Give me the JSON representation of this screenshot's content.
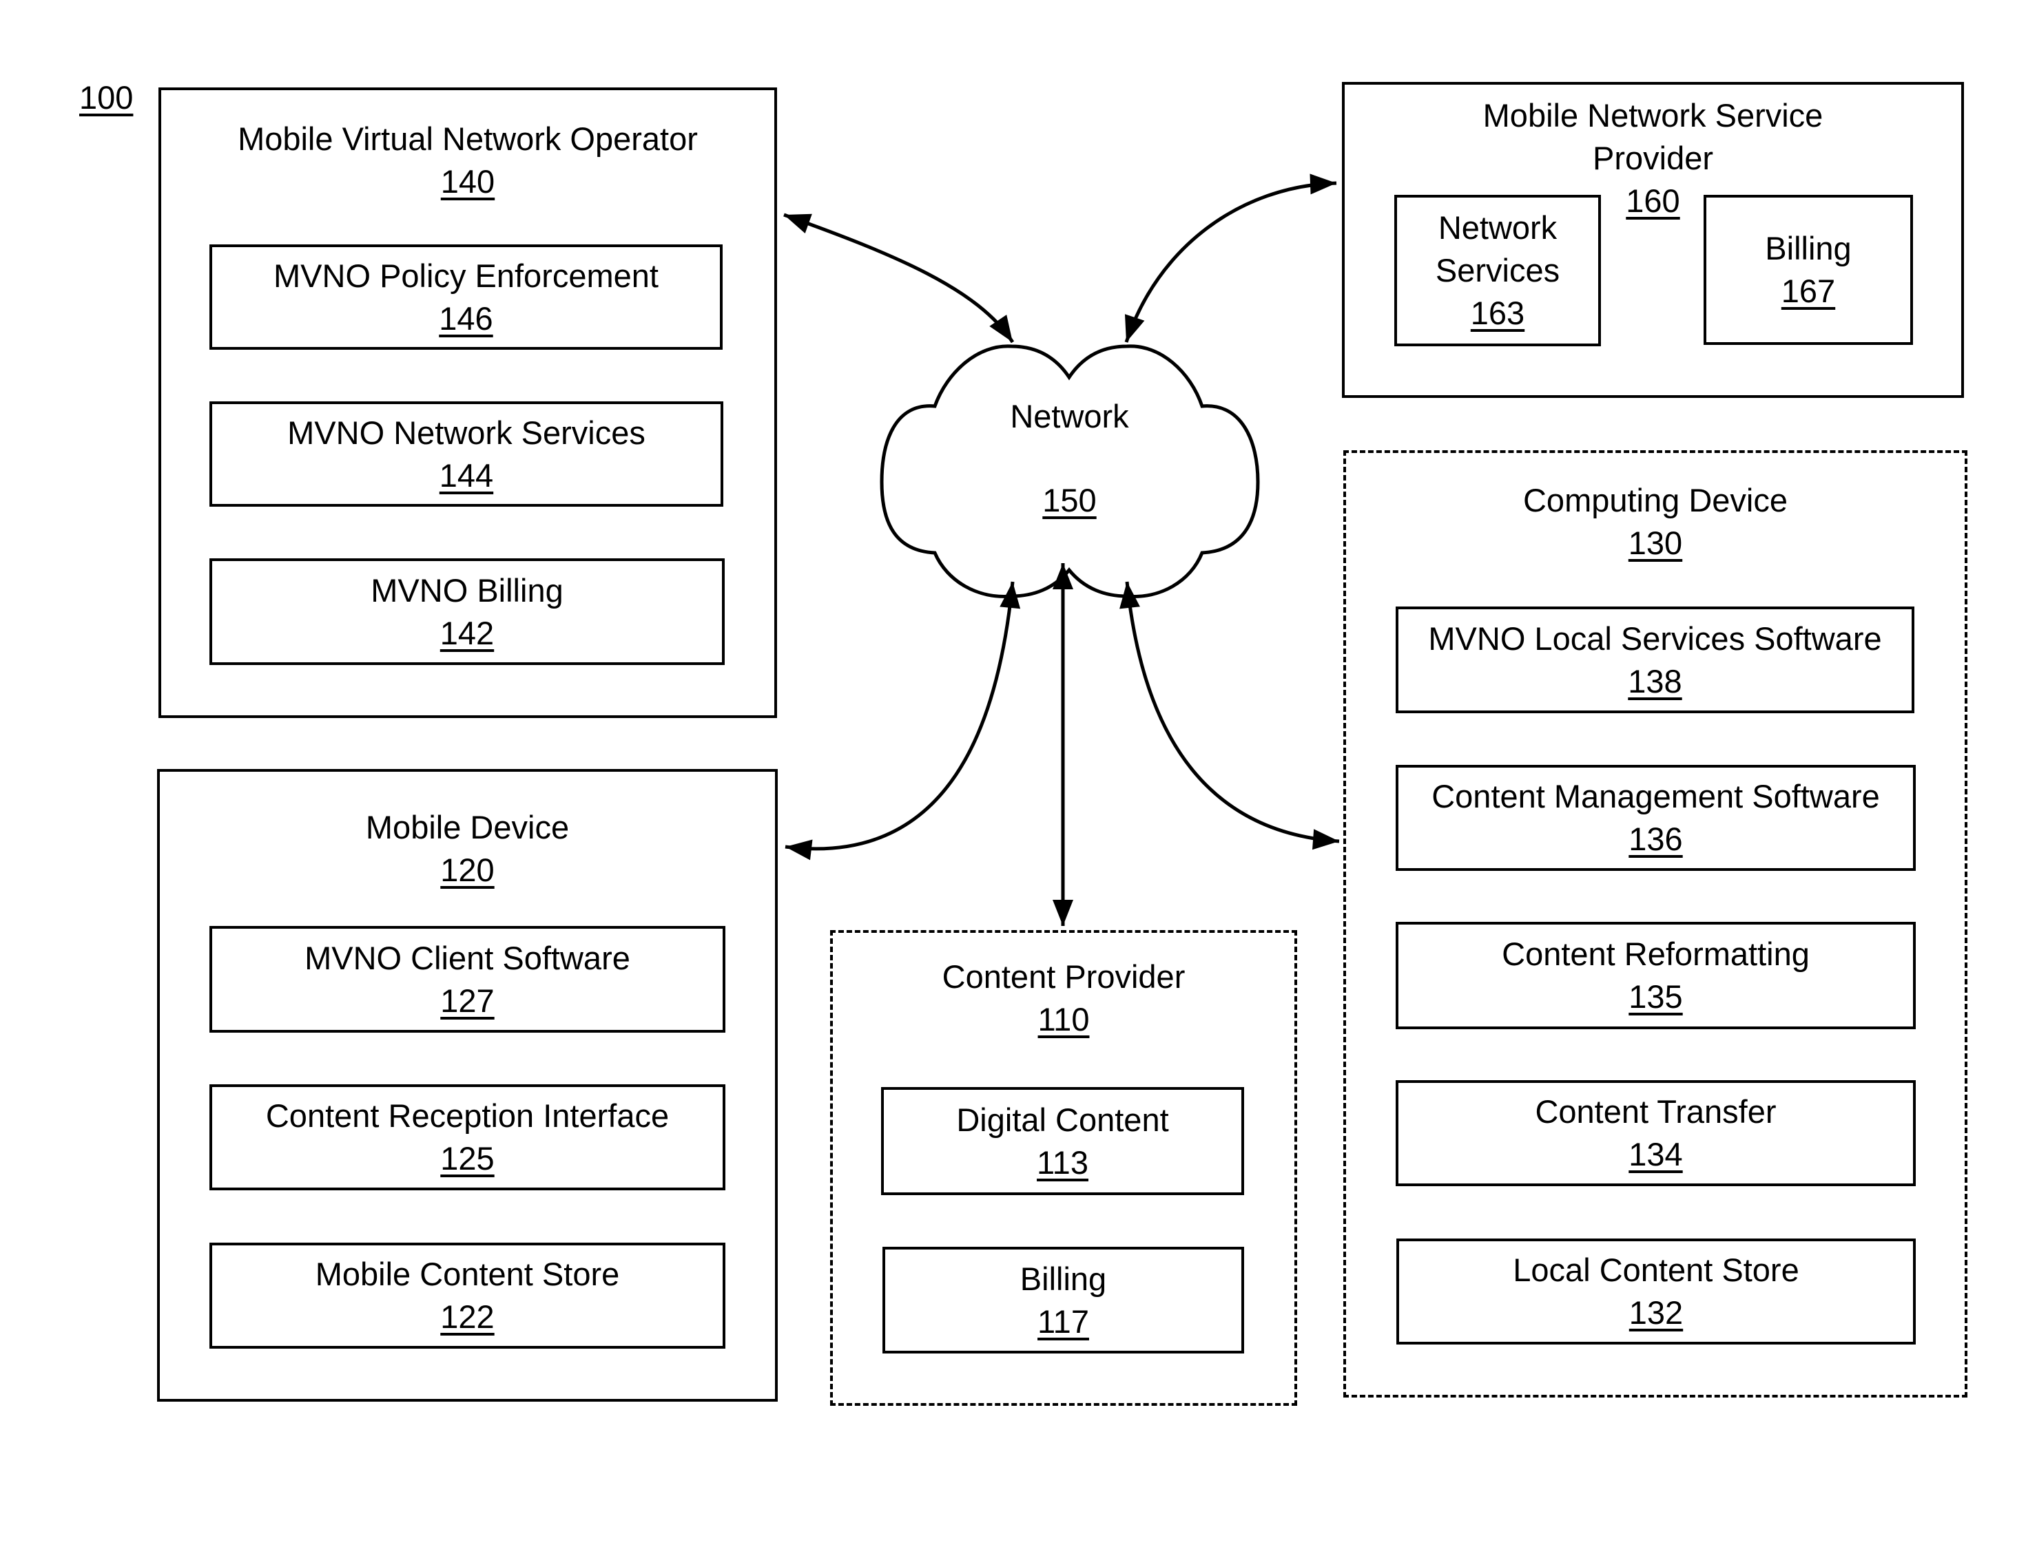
{
  "figure_ref": "100",
  "network": {
    "label": "Network",
    "ref": "150"
  },
  "mvno": {
    "title": "Mobile Virtual Network Operator",
    "ref": "140",
    "components": [
      {
        "label": "MVNO Policy Enforcement",
        "ref": "146"
      },
      {
        "label": "MVNO Network Services",
        "ref": "144"
      },
      {
        "label": "MVNO Billing",
        "ref": "142"
      }
    ]
  },
  "mnsp": {
    "title_line1": "Mobile Network Service",
    "title_line2": "Provider",
    "ref": "160",
    "components": [
      {
        "label_line1": "Network",
        "label_line2": "Services",
        "ref": "163"
      },
      {
        "label": "Billing",
        "ref": "167"
      }
    ]
  },
  "mobile_device": {
    "title": "Mobile Device",
    "ref": "120",
    "components": [
      {
        "label": "MVNO Client Software",
        "ref": "127"
      },
      {
        "label": "Content Reception Interface",
        "ref": "125"
      },
      {
        "label": "Mobile Content Store",
        "ref": "122"
      }
    ]
  },
  "content_provider": {
    "title": "Content Provider",
    "ref": "110",
    "components": [
      {
        "label": "Digital Content",
        "ref": "113"
      },
      {
        "label": "Billing",
        "ref": "117"
      }
    ]
  },
  "computing_device": {
    "title": "Computing Device",
    "ref": "130",
    "components": [
      {
        "label": "MVNO Local Services Software",
        "ref": "138"
      },
      {
        "label": "Content Management Software",
        "ref": "136"
      },
      {
        "label": "Content Reformatting",
        "ref": "135"
      },
      {
        "label": "Content Transfer",
        "ref": "134"
      },
      {
        "label": "Local Content Store",
        "ref": "132"
      }
    ]
  },
  "connections": [
    {
      "from": "network",
      "to": "mvno",
      "bidirectional": true
    },
    {
      "from": "network",
      "to": "mnsp",
      "bidirectional": true
    },
    {
      "from": "network",
      "to": "mobile_device",
      "bidirectional": true
    },
    {
      "from": "network",
      "to": "content_provider",
      "bidirectional": true
    },
    {
      "from": "network",
      "to": "computing_device",
      "bidirectional": true
    }
  ]
}
